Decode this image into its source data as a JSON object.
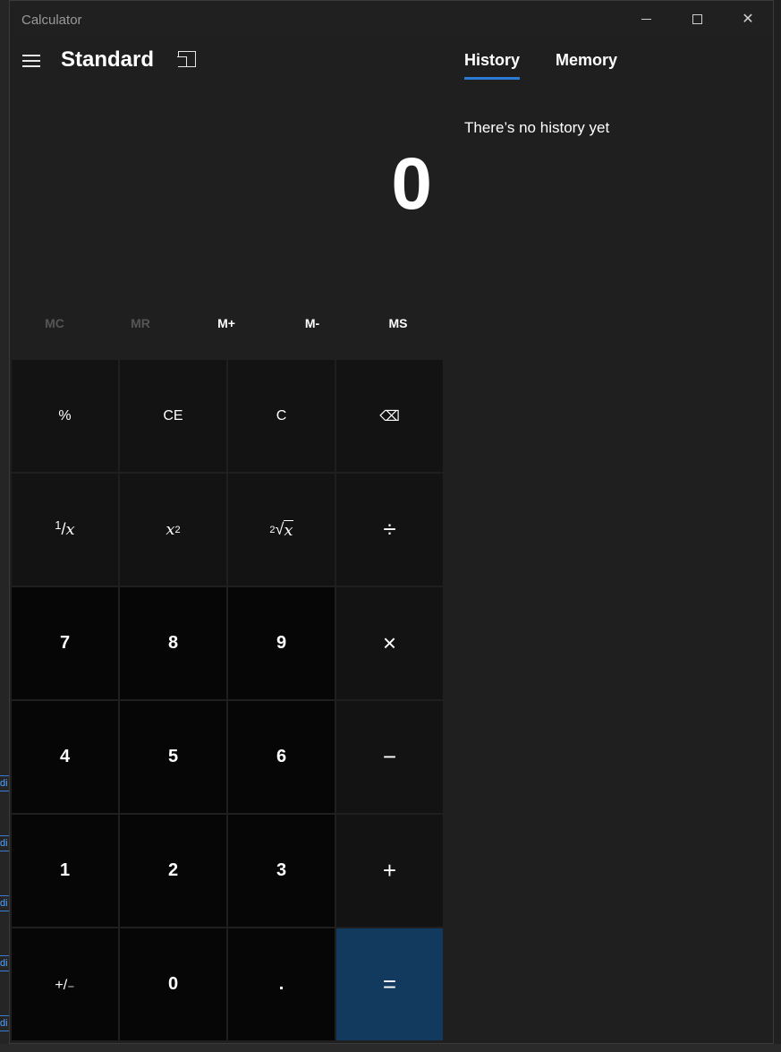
{
  "app": {
    "title": "Calculator"
  },
  "window_controls": {
    "minimize": "minimize",
    "maximize": "maximize",
    "close": "✕"
  },
  "header": {
    "mode": "Standard"
  },
  "display": {
    "value": "0"
  },
  "memory": {
    "buttons": [
      {
        "label": "MC",
        "enabled": false
      },
      {
        "label": "MR",
        "enabled": false
      },
      {
        "label": "M+",
        "enabled": true
      },
      {
        "label": "M-",
        "enabled": true
      },
      {
        "label": "MS",
        "enabled": true
      }
    ]
  },
  "keys": {
    "percent": "%",
    "ce": "CE",
    "c": "C",
    "backspace": "⌫",
    "reciprocal_num": "1",
    "reciprocal_den": "x",
    "square_base": "x",
    "square_exp": "2",
    "sqrt_index": "2",
    "sqrt_symbol": "√",
    "sqrt_arg": "x",
    "divide": "÷",
    "seven": "7",
    "eight": "8",
    "nine": "9",
    "multiply": "×",
    "four": "4",
    "five": "5",
    "six": "6",
    "minus": "−",
    "one": "1",
    "two": "2",
    "three": "3",
    "plus": "+",
    "negate": "+/₋",
    "zero": "0",
    "decimal": ".",
    "equals": "="
  },
  "side_panel": {
    "tabs": [
      "History",
      "Memory"
    ],
    "active_tab": "History",
    "empty_message": "There’s no history yet"
  },
  "colors": {
    "accent": "#2b7bd4",
    "equals_bg": "#123a5e",
    "window_bg": "#1f1f1f"
  }
}
